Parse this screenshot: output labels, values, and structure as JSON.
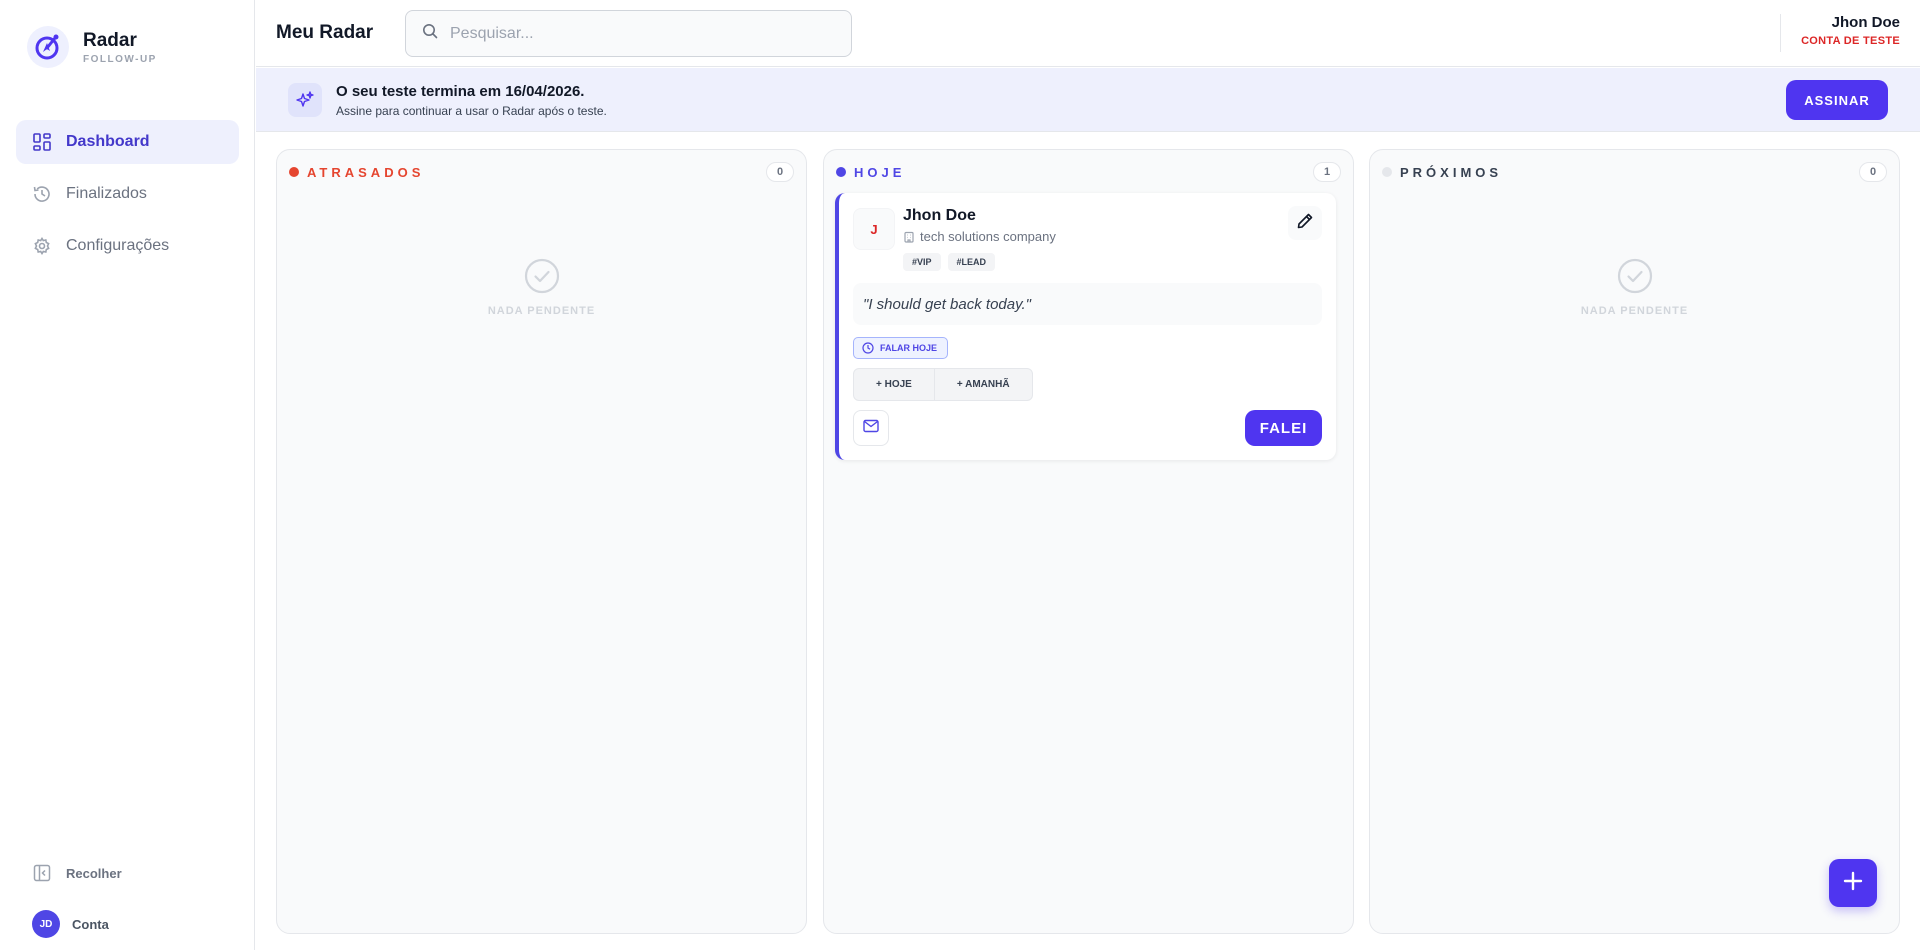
{
  "app": {
    "name": "Radar",
    "tagline": "FOLLOW-UP"
  },
  "sidebar": {
    "items": [
      {
        "label": "Dashboard",
        "icon": "dashboard-icon",
        "active": true
      },
      {
        "label": "Finalizados",
        "icon": "history-icon",
        "active": false
      },
      {
        "label": "Configurações",
        "icon": "gear-icon",
        "active": false
      }
    ],
    "collapse_label": "Recolher",
    "account_label": "Conta",
    "account_initials": "JD"
  },
  "header": {
    "title": "Meu Radar",
    "search_placeholder": "Pesquisar...",
    "user_name": "Jhon Doe",
    "user_role": "CONTA DE TESTE"
  },
  "banner": {
    "title": "O seu teste termina em 16/04/2026.",
    "subtitle": "Assine para continuar a usar o Radar após o teste.",
    "button_label": "ASSINAR"
  },
  "columns": [
    {
      "title": "ATRASADOS",
      "count": "0",
      "color": "#e5452f",
      "empty_label": "NADA PENDENTE"
    },
    {
      "title": "HOJE",
      "count": "1",
      "color": "#4f46e5"
    },
    {
      "title": "PRÓXIMOS",
      "count": "0",
      "color": "#374151",
      "empty_label": "NADA PENDENTE"
    }
  ],
  "card": {
    "initial": "J",
    "name": "Jhon Doe",
    "company": "tech solutions company",
    "tags": [
      "#VIP",
      "#LEAD"
    ],
    "note": "\"I should get back today.\"",
    "due_badge": "FALAR HOJE",
    "snooze_options": [
      "+ HOJE",
      "+ AMANHÃ"
    ],
    "primary_action": "FALEI"
  },
  "colors": {
    "accent": "#4f35f0",
    "danger": "#dc2626"
  }
}
